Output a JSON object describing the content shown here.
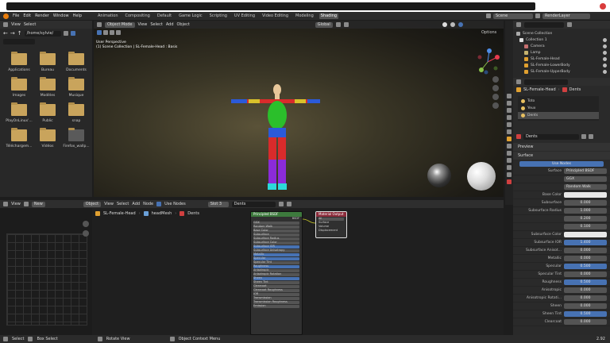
{
  "menu": {
    "items": [
      "File",
      "Edit",
      "Render",
      "Window",
      "Help"
    ]
  },
  "workspaces": [
    {
      "label": "Animation"
    },
    {
      "label": "Compositing"
    },
    {
      "label": "Default"
    },
    {
      "label": "Game Logic"
    },
    {
      "label": "Scripting"
    },
    {
      "label": "UV Editing"
    },
    {
      "label": "Video Editing"
    },
    {
      "label": "Modeling"
    },
    {
      "label": "Shading"
    }
  ],
  "scene": {
    "name": "Scene",
    "layer": "RenderLayer"
  },
  "file_browser": {
    "menus": [
      "View",
      "Select"
    ],
    "path": "/home/sylvie/",
    "items": [
      {
        "label": "Applications"
      },
      {
        "label": "Bureau"
      },
      {
        "label": "Documents"
      },
      {
        "label": "Images"
      },
      {
        "label": "Modèles"
      },
      {
        "label": "Musique"
      },
      {
        "label": "PlayOnLinux'..."
      },
      {
        "label": "Public"
      },
      {
        "label": "snap"
      },
      {
        "label": "Téléchargem..."
      },
      {
        "label": "Vidéos"
      },
      {
        "label": "Firefox_wallp..."
      }
    ]
  },
  "viewport": {
    "mode": "Object Mode",
    "menus": [
      "View",
      "Select",
      "Add",
      "Object"
    ],
    "transform": "Global",
    "options": "Options",
    "title": "User Perspective",
    "subtitle": "(1) Scene Collection | SL-Female-Head : Basis"
  },
  "node_editor": {
    "menus": [
      "View",
      "Select",
      "Add",
      "Node"
    ],
    "object": "Object",
    "use_nodes": "Use Nodes",
    "new": "New",
    "slot": "Slot 3",
    "material": "Dents",
    "breadcrumb": [
      "SL-Female-Head",
      "headMesh",
      "Dents"
    ],
    "principled": {
      "title": "Principled BSDF",
      "rows": [
        "BSDF",
        "GGX",
        "Random Walk",
        "Base Color",
        "Subsurface",
        "Subsurface Radius",
        "Subsurface Color",
        "Subsurface IOR",
        "Subsurface Anisotropy",
        "Metallic",
        "Specular",
        "Specular Tint",
        "Roughness",
        "Anisotropic",
        "Anisotropic Rotation",
        "Sheen",
        "Sheen Tint",
        "Clearcoat",
        "Clearcoat Roughness",
        "IOR",
        "Transmission",
        "Transmission Roughness",
        "Emission"
      ]
    },
    "output": {
      "title": "Material Output",
      "rows": [
        "All",
        "Surface",
        "Volume",
        "Displacement"
      ]
    }
  },
  "outliner": {
    "title": "Scene Collection",
    "items": [
      {
        "label": "Collection 1"
      },
      {
        "label": "Camera"
      },
      {
        "label": "Lamp"
      },
      {
        "label": "SL-Female-Head"
      },
      {
        "label": "SL-Female-LowerBody"
      },
      {
        "label": "SL-Female-UpperBody"
      }
    ]
  },
  "properties": {
    "object": "SL-Female-Head",
    "material": "Dents",
    "slots": [
      {
        "label": "Toto"
      },
      {
        "label": "Yeux"
      },
      {
        "label": "Dents"
      }
    ],
    "material_name": "Dents",
    "sections": {
      "preview": "Preview",
      "surface": "Surface"
    },
    "use_nodes": "Use Nodes",
    "surface": {
      "label": "Surface",
      "value": "Principled BSDF"
    },
    "distribution": "GGX",
    "subsurface_method": "Random Walk",
    "rows": [
      {
        "label": "Base Color",
        "value": "",
        "style": "white"
      },
      {
        "label": "Subsurface",
        "value": "0.000",
        "style": ""
      },
      {
        "label": "Subsurface Radius",
        "value": "1.000",
        "style": ""
      },
      {
        "label": "",
        "value": "0.200",
        "style": ""
      },
      {
        "label": "",
        "value": "0.100",
        "style": ""
      },
      {
        "label": "Subsurface Color",
        "value": "",
        "style": "white"
      },
      {
        "label": "Subsurface IOR",
        "value": "1.400",
        "style": "blue"
      },
      {
        "label": "Subsurface Anisot...",
        "value": "0.000",
        "style": ""
      },
      {
        "label": "Metallic",
        "value": "0.000",
        "style": ""
      },
      {
        "label": "Specular",
        "value": "0.500",
        "style": "blue"
      },
      {
        "label": "Specular Tint",
        "value": "0.000",
        "style": ""
      },
      {
        "label": "Roughness",
        "value": "0.500",
        "style": "blue"
      },
      {
        "label": "Anisotropic",
        "value": "0.000",
        "style": ""
      },
      {
        "label": "Anisotropic Rotati...",
        "value": "0.000",
        "style": ""
      },
      {
        "label": "Sheen",
        "value": "0.000",
        "style": ""
      },
      {
        "label": "Sheen Tint",
        "value": "0.500",
        "style": "blue"
      },
      {
        "label": "Clearcoat",
        "value": "0.000",
        "style": ""
      }
    ]
  },
  "status": {
    "select": "Select",
    "box_select": "Box Select",
    "rotate": "Rotate View",
    "context": "Object Context Menu",
    "version": "2.92"
  }
}
